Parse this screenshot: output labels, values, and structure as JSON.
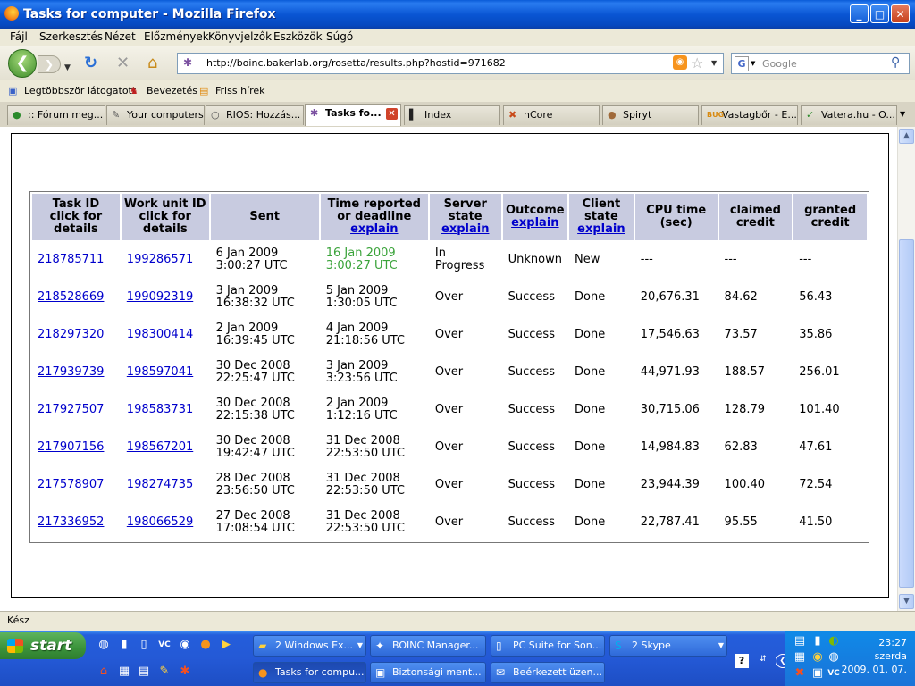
{
  "window": {
    "title": "Tasks for computer - Mozilla Firefox",
    "buttons": {
      "minimize": "_",
      "maximize": "□",
      "close": "✕"
    }
  },
  "menu": [
    "Fájl",
    "Szerkesztés",
    "Nézet",
    "Előzmények",
    "Könyvjelzők",
    "Eszközök",
    "Súgó"
  ],
  "nav": {
    "url": "http://boinc.bakerlab.org/rosetta/results.php?hostid=971682",
    "search_placeholder": "Google"
  },
  "bookmarks": [
    "Legtöbbször látogatott",
    "Bevezetés",
    "Friss hírek"
  ],
  "tabs": [
    {
      "label": ":: Fórum meg...",
      "icon": "globe-icon"
    },
    {
      "label": "Your computers",
      "icon": "boinc-icon"
    },
    {
      "label": "RIOS: Hozzás...",
      "icon": "rios-icon"
    },
    {
      "label": "Tasks fo...",
      "icon": "rosetta-icon",
      "active": true
    },
    {
      "label": "Index",
      "icon": "index-icon"
    },
    {
      "label": "nCore",
      "icon": "ncore-icon"
    },
    {
      "label": "Spiryt",
      "icon": "spiryt-icon"
    },
    {
      "label": "Vastagbőr - E...",
      "icon": "bug-icon"
    },
    {
      "label": "Vatera.hu - O...",
      "icon": "vatera-icon"
    }
  ],
  "table": {
    "headers": [
      {
        "l1": "Task ID",
        "l2": "click for",
        "l3": "details"
      },
      {
        "l1": "Work unit ID",
        "l2": "click for",
        "l3": "details"
      },
      {
        "l1": "Sent"
      },
      {
        "l1": "Time reported",
        "l2": "or deadline",
        "link": "explain"
      },
      {
        "l1": "Server",
        "l2": "state",
        "link": "explain"
      },
      {
        "l1": "Outcome",
        "link": "explain"
      },
      {
        "l1": "Client",
        "l2": "state",
        "link": "explain"
      },
      {
        "l1": "CPU time",
        "l2": "(sec)"
      },
      {
        "l1": "claimed",
        "l2": "credit"
      },
      {
        "l1": "granted",
        "l2": "credit"
      }
    ],
    "rows": [
      {
        "task": "218785711",
        "wu": "199286571",
        "sent1": "6 Jan 2009",
        "sent2": "3:00:27 UTC",
        "rep1": "16 Jan 2009",
        "rep2": "3:00:27 UTC",
        "server1": "In",
        "server2": "Progress",
        "outcome": "Unknown",
        "client": "New",
        "cpu": "---",
        "claimed": "---",
        "granted": "---"
      },
      {
        "task": "218528669",
        "wu": "199092319",
        "sent1": "3 Jan 2009",
        "sent2": "16:38:32 UTC",
        "rep1": "5 Jan 2009",
        "rep2": "1:30:05 UTC",
        "server1": "Over",
        "server2": "",
        "outcome": "Success",
        "client": "Done",
        "cpu": "20,676.31",
        "claimed": "84.62",
        "granted": "56.43"
      },
      {
        "task": "218297320",
        "wu": "198300414",
        "sent1": "2 Jan 2009",
        "sent2": "16:39:45 UTC",
        "rep1": "4 Jan 2009",
        "rep2": "21:18:56 UTC",
        "server1": "Over",
        "server2": "",
        "outcome": "Success",
        "client": "Done",
        "cpu": "17,546.63",
        "claimed": "73.57",
        "granted": "35.86"
      },
      {
        "task": "217939739",
        "wu": "198597041",
        "sent1": "30 Dec 2008",
        "sent2": "22:25:47 UTC",
        "rep1": "3 Jan 2009",
        "rep2": "3:23:56 UTC",
        "server1": "Over",
        "server2": "",
        "outcome": "Success",
        "client": "Done",
        "cpu": "44,971.93",
        "claimed": "188.57",
        "granted": "256.01"
      },
      {
        "task": "217927507",
        "wu": "198583731",
        "sent1": "30 Dec 2008",
        "sent2": "22:15:38 UTC",
        "rep1": "2 Jan 2009",
        "rep2": "1:12:16 UTC",
        "server1": "Over",
        "server2": "",
        "outcome": "Success",
        "client": "Done",
        "cpu": "30,715.06",
        "claimed": "128.79",
        "granted": "101.40"
      },
      {
        "task": "217907156",
        "wu": "198567201",
        "sent1": "30 Dec 2008",
        "sent2": "19:42:47 UTC",
        "rep1": "31 Dec 2008",
        "rep2": "22:53:50 UTC",
        "server1": "Over",
        "server2": "",
        "outcome": "Success",
        "client": "Done",
        "cpu": "14,984.83",
        "claimed": "62.83",
        "granted": "47.61"
      },
      {
        "task": "217578907",
        "wu": "198274735",
        "sent1": "28 Dec 2008",
        "sent2": "23:56:50 UTC",
        "rep1": "31 Dec 2008",
        "rep2": "22:53:50 UTC",
        "server1": "Over",
        "server2": "",
        "outcome": "Success",
        "client": "Done",
        "cpu": "23,944.39",
        "claimed": "100.40",
        "granted": "72.54"
      },
      {
        "task": "217336952",
        "wu": "198066529",
        "sent1": "27 Dec 2008",
        "sent2": "17:08:54 UTC",
        "rep1": "31 Dec 2008",
        "rep2": "22:53:50 UTC",
        "server1": "Over",
        "server2": "",
        "outcome": "Success",
        "client": "Done",
        "cpu": "22,787.41",
        "claimed": "95.55",
        "granted": "41.50"
      }
    ]
  },
  "status": "Kész",
  "taskbar": {
    "start": "start",
    "row1": [
      {
        "label": "2 Windows Ex...",
        "icon": "folder-icon"
      },
      {
        "label": "BOINC Manager...",
        "icon": "boinc-icon"
      },
      {
        "label": "PC Suite for Son...",
        "icon": "phone-icon"
      },
      {
        "label": "2 Skype",
        "icon": "skype-icon"
      }
    ],
    "row2": [
      {
        "label": "Tasks for compu...",
        "icon": "firefox-icon",
        "active": true
      },
      {
        "label": "Biztonsági ment...",
        "icon": "backup-icon"
      },
      {
        "label": "Beérkezett üzen...",
        "icon": "mail-icon"
      }
    ],
    "clock_time": "23:27",
    "clock_day": "szerda",
    "clock_date": "2009. 01. 07."
  },
  "colors": {
    "header_bg": "#c8cbe0",
    "link": "#0000cc",
    "deadline_green": "#3aa33a"
  }
}
